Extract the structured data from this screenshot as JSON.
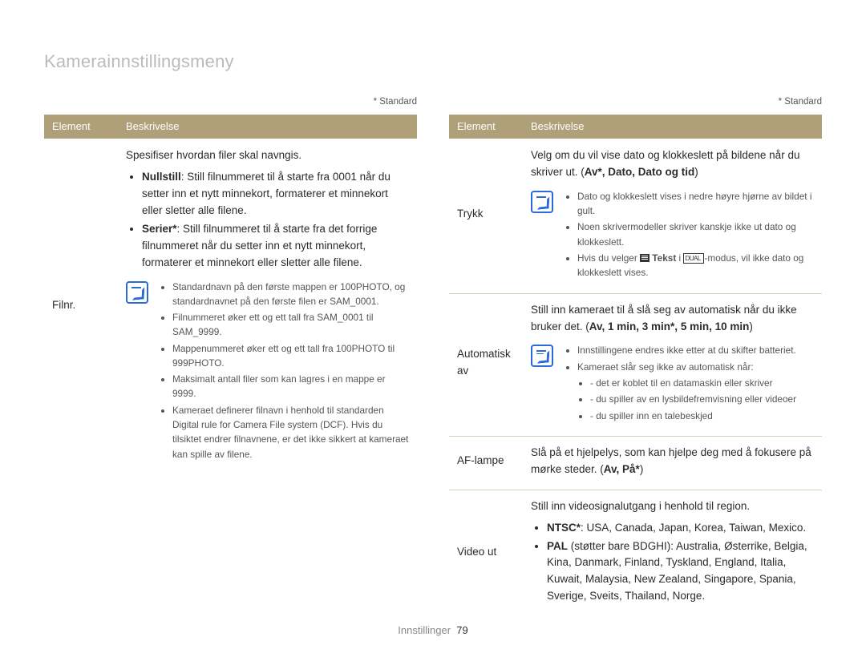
{
  "page_title": "Kamerainnstillingsmeny",
  "standard_note": "* Standard",
  "headers": {
    "element": "Element",
    "description": "Beskrivelse"
  },
  "footer": {
    "section": "Innstillinger",
    "page": "79"
  },
  "left": {
    "rows": [
      {
        "label": "Filnr.",
        "intro": "Spesifiser hvordan filer skal navngis.",
        "bullets": [
          {
            "strong": "Nullstill",
            "text": ": Still filnummeret til å starte fra 0001 når du setter inn et nytt minnekort, formaterer et minnekort eller sletter alle filene."
          },
          {
            "strong": "Serier*",
            "text": ": Still filnummeret til å starte fra det forrige filnummeret når du setter inn et nytt minnekort, formaterer et minnekort eller sletter alle filene."
          }
        ],
        "note": [
          "Standardnavn på den første mappen er 100PHOTO, og standardnavnet på den første filen er SAM_0001.",
          "Filnummeret øker ett og ett tall fra SAM_0001 til SAM_9999.",
          "Mappenummeret øker ett og ett tall fra 100PHOTO til 999PHOTO.",
          "Maksimalt antall filer som kan lagres i en mappe er 9999.",
          "Kameraet definerer filnavn i henhold til standarden Digital rule for Camera File system (DCF). Hvis du tilsiktet endrer filnavnene, er det ikke sikkert at kameraet kan spille av filene."
        ]
      }
    ]
  },
  "right": {
    "rows": [
      {
        "label": "Trykk",
        "intro_a": "Velg om du vil vise dato og klokkeslett på bildene når du skriver ut. (",
        "opts": "Av*, Dato, Dato og tid",
        "intro_b": ")",
        "note": [
          "Dato og klokkeslett vises i nedre høyre hjørne av bildet i gult.",
          "Noen skrivermodeller skriver kanskje ikke ut dato og klokkeslett."
        ],
        "note_special_a": "Hvis du velger ",
        "note_special_b": " Tekst ",
        "note_special_c": " i ",
        "note_special_d": "-modus, vil ikke dato og klokkeslett vises."
      },
      {
        "label": "Automatisk av",
        "intro_a": "Still inn kameraet til å slå seg av automatisk når du ikke bruker det. (",
        "opts": "Av, 1 min, 3 min*, 5 min, 10 min",
        "intro_b": ")",
        "note": [
          "Innstillingene endres ikke etter at du skifter batteriet.",
          "Kameraet slår seg ikke av automatisk når:"
        ],
        "sub": [
          "det er koblet til en datamaskin eller skriver",
          "du spiller av en lysbildefremvisning eller videoer",
          "du spiller inn en talebeskjed"
        ]
      },
      {
        "label": "AF-lampe",
        "text_a": "Slå på et hjelpelys, som kan hjelpe deg med å fokusere på mørke steder. (",
        "opts": "Av, På*",
        "text_b": ")"
      },
      {
        "label": "Video ut",
        "intro": "Still inn videosignalutgang i henhold til region.",
        "bullets": [
          {
            "strong": "NTSC*",
            "text": ": USA, Canada, Japan, Korea, Taiwan, Mexico."
          },
          {
            "strong": "PAL",
            "suffix": " (støtter bare BDGHI)",
            "text": ": Australia, Østerrike, Belgia, Kina, Danmark, Finland, Tyskland, England, Italia, Kuwait, Malaysia, New Zealand, Singapore, Spania, Sverige, Sveits, Thailand, Norge."
          }
        ]
      }
    ]
  }
}
